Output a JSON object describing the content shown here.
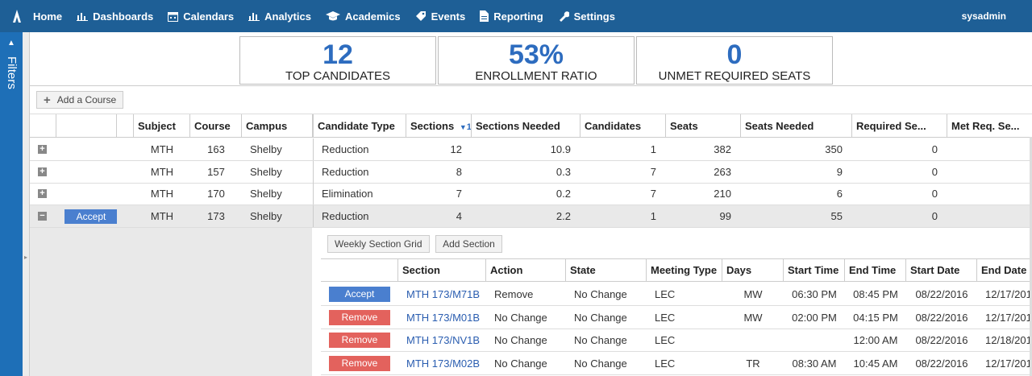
{
  "nav": {
    "items": [
      {
        "label": "Home",
        "icon": "home-icon"
      },
      {
        "label": "Dashboards",
        "icon": "bar-chart-icon"
      },
      {
        "label": "Calendars",
        "icon": "calendar-icon"
      },
      {
        "label": "Analytics",
        "icon": "bar-chart-icon"
      },
      {
        "label": "Academics",
        "icon": "graduation-cap-icon"
      },
      {
        "label": "Events",
        "icon": "tag-icon"
      },
      {
        "label": "Reporting",
        "icon": "document-icon"
      },
      {
        "label": "Settings",
        "icon": "wrench-icon"
      }
    ],
    "user": "sysadmin"
  },
  "filters": {
    "label": "Filters"
  },
  "stats": [
    {
      "value": "12",
      "label": "TOP CANDIDATES"
    },
    {
      "value": "53%",
      "label": "ENROLLMENT RATIO"
    },
    {
      "value": "0",
      "label": "UNMET REQUIRED SEATS"
    }
  ],
  "toolbar": {
    "add_course": "Add a Course"
  },
  "grid": {
    "headers": [
      "Subject",
      "Course",
      "Campus",
      "Candidate Type",
      "Sections",
      "Sections Needed",
      "Candidates",
      "Seats",
      "Seats Needed",
      "Required Se...",
      "Met Req. Se..."
    ],
    "sort_indicator": "1",
    "rows": [
      {
        "expander": "+",
        "action": "",
        "subject": "MTH",
        "course": "163",
        "campus": "Shelby",
        "type": "Reduction",
        "sections": "12",
        "needed": "10.9",
        "candidates": "1",
        "seats": "382",
        "seats_needed": "350",
        "required": "0"
      },
      {
        "expander": "+",
        "action": "",
        "subject": "MTH",
        "course": "157",
        "campus": "Shelby",
        "type": "Reduction",
        "sections": "8",
        "needed": "0.3",
        "candidates": "7",
        "seats": "263",
        "seats_needed": "9",
        "required": "0"
      },
      {
        "expander": "+",
        "action": "",
        "subject": "MTH",
        "course": "170",
        "campus": "Shelby",
        "type": "Elimination",
        "sections": "7",
        "needed": "0.2",
        "candidates": "7",
        "seats": "210",
        "seats_needed": "6",
        "required": "0"
      },
      {
        "expander": "−",
        "action": "Accept",
        "subject": "MTH",
        "course": "173",
        "campus": "Shelby",
        "type": "Reduction",
        "sections": "4",
        "needed": "2.2",
        "candidates": "1",
        "seats": "99",
        "seats_needed": "55",
        "required": "0"
      }
    ]
  },
  "subgrid": {
    "buttons": {
      "weekly": "Weekly Section Grid",
      "add_section": "Add Section"
    },
    "headers": [
      "Section",
      "Action",
      "State",
      "Meeting Type",
      "Days",
      "Start Time",
      "End Time",
      "Start Date",
      "End Date"
    ],
    "rows": [
      {
        "button": "Accept",
        "section": "MTH 173/M71B",
        "action": "Remove",
        "state": "No Change",
        "meeting": "LEC",
        "days": "MW",
        "start": "06:30 PM",
        "end": "08:45 PM",
        "start_date": "08/22/2016",
        "end_date": "12/17/201"
      },
      {
        "button": "Remove",
        "section": "MTH 173/M01B",
        "action": "No Change",
        "state": "No Change",
        "meeting": "LEC",
        "days": "MW",
        "start": "02:00 PM",
        "end": "04:15 PM",
        "start_date": "08/22/2016",
        "end_date": "12/17/201"
      },
      {
        "button": "Remove",
        "section": "MTH 173/NV1B",
        "action": "No Change",
        "state": "No Change",
        "meeting": "LEC",
        "days": "",
        "start": "",
        "end": "12:00 AM",
        "start_date": "08/22/2016",
        "end_date": "12/18/201"
      },
      {
        "button": "Remove",
        "section": "MTH 173/M02B",
        "action": "No Change",
        "state": "No Change",
        "meeting": "LEC",
        "days": "TR",
        "start": "08:30 AM",
        "end": "10:45 AM",
        "start_date": "08/22/2016",
        "end_date": "12/17/201"
      }
    ]
  },
  "colors": {
    "nav": "#1e5f96",
    "accent": "#2d6cbf",
    "accept": "#4a7fcf",
    "remove": "#e3625d"
  }
}
